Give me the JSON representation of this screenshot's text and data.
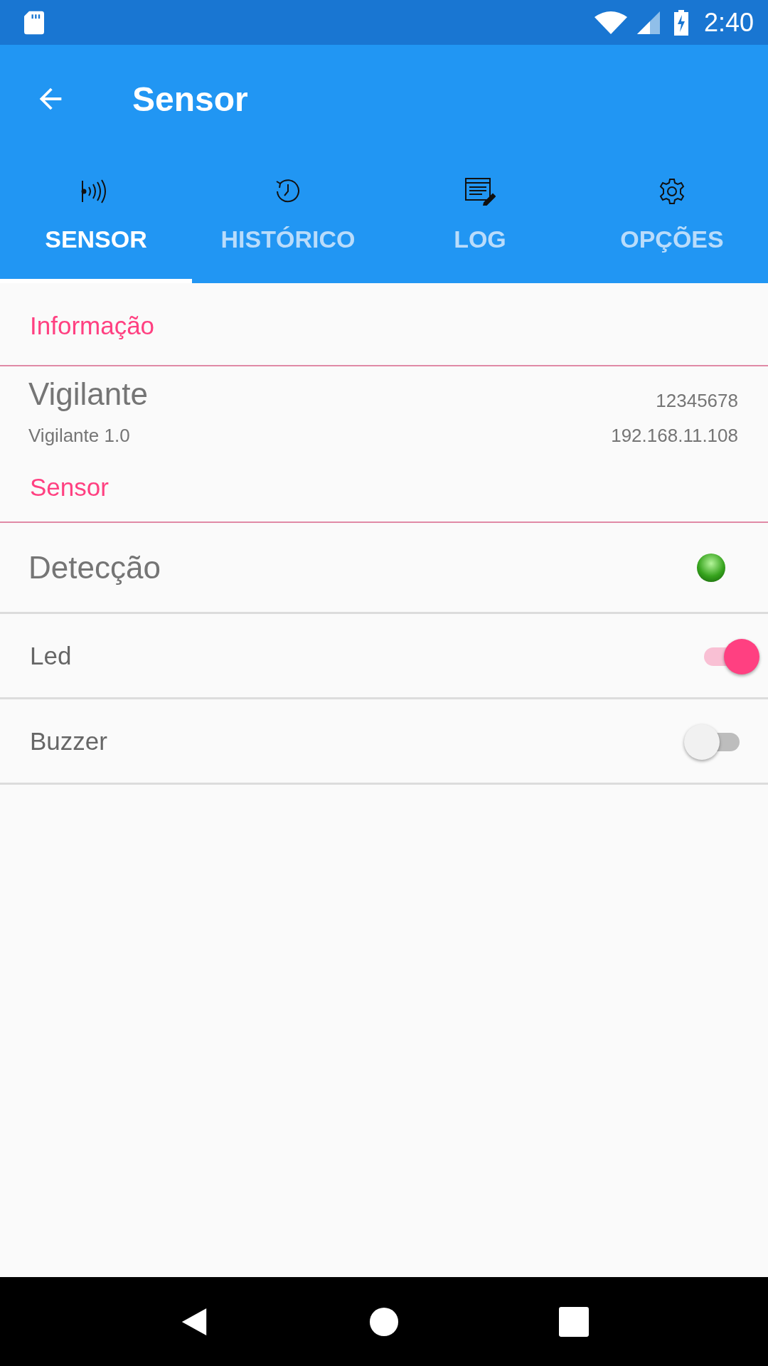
{
  "status_bar": {
    "time": "2:40"
  },
  "app_bar": {
    "title": "Sensor"
  },
  "tabs": [
    {
      "label": "SENSOR",
      "selected": true
    },
    {
      "label": "HISTÓRICO",
      "selected": false
    },
    {
      "label": "LOG",
      "selected": false
    },
    {
      "label": "OPÇÕES",
      "selected": false
    }
  ],
  "info_section": {
    "header": "Informação",
    "device_name": "Vigilante",
    "serial": "12345678",
    "version": "Vigilante 1.0",
    "ip": "192.168.11.108"
  },
  "sensor_section": {
    "header": "Sensor",
    "detection": {
      "label": "Detecção",
      "on": true
    },
    "switches": [
      {
        "label": "Led",
        "on": true
      },
      {
        "label": "Buzzer",
        "on": false
      }
    ]
  }
}
